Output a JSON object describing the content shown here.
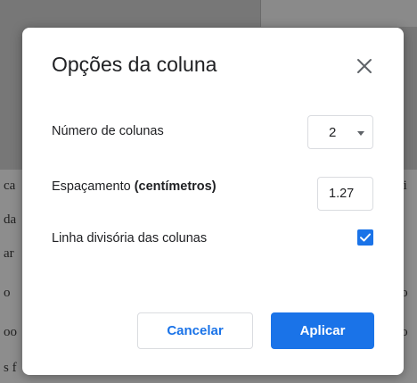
{
  "background_fragments": {
    "left": [
      "ca",
      "da",
      "ar",
      "o",
      "oo",
      "s f"
    ],
    "right": [
      "ci",
      "",
      "",
      "io",
      "io",
      ""
    ]
  },
  "dialog": {
    "title": "Opções da coluna",
    "close_icon": "close-icon",
    "columns": {
      "label": "Número de colunas",
      "value": "2",
      "icon": "chevron-down-icon"
    },
    "spacing": {
      "label_prefix": "Espaçamento ",
      "label_bold": "(centímetros)",
      "value": "1.27"
    },
    "divider": {
      "label": "Linha divisória das colunas",
      "checked": true,
      "icon": "check-icon"
    },
    "buttons": {
      "cancel": "Cancelar",
      "apply": "Aplicar"
    }
  },
  "colors": {
    "accent": "#1a73e8",
    "text": "#202124",
    "border": "#dadce0",
    "overlay": "#7a7a7a"
  }
}
